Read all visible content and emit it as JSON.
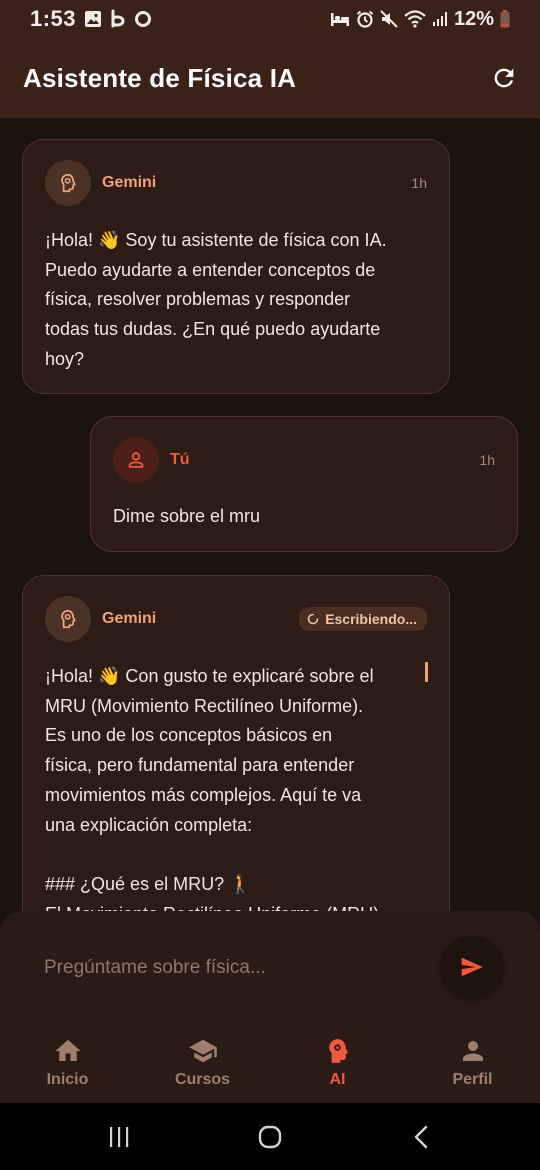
{
  "status_bar": {
    "time": "1:53",
    "battery": "12%",
    "left_icons": [
      "image-icon",
      "b-app-icon",
      "o-app-icon"
    ],
    "right_icons": [
      "bed-icon",
      "alarm-icon",
      "mute-icon",
      "wifi-icon",
      "signal-icon",
      "battery-icon"
    ]
  },
  "app_bar": {
    "title": "Asistente de Física IA",
    "refresh_icon": "refresh-icon"
  },
  "messages": [
    {
      "sender": "Gemini",
      "time": "1h",
      "text": "¡Hola! 👋 Soy tu asistente de física con IA.\nPuedo ayudarte a entender conceptos de\nfísica, resolver problemas y responder\ntodas tus dudas. ¿En qué puedo ayudarte\nhoy?"
    },
    {
      "sender": "Tú",
      "time": "1h",
      "text": "Dime sobre el mru"
    },
    {
      "sender": "Gemini",
      "status": "Escribiendo...",
      "text": "¡Hola! 👋 Con gusto te explicaré sobre el\nMRU (Movimiento Rectilíneo Uniforme).\nEs uno de los conceptos básicos en\nfísica, pero fundamental para entender\nmovimientos más complejos. Aquí te va\nuna explicación completa:\n\n### ¿Qué es el MRU? 🚶\nEl Movimiento Rectilíneo Uniforme (MRU)"
    }
  ],
  "input": {
    "placeholder": "Pregúntame sobre física...",
    "value": ""
  },
  "bottom_nav": [
    {
      "label": "Inicio",
      "icon": "home-icon",
      "active": false
    },
    {
      "label": "Cursos",
      "icon": "school-icon",
      "active": false
    },
    {
      "label": "AI",
      "icon": "psychology-icon",
      "active": true
    },
    {
      "label": "Perfil",
      "icon": "person-icon",
      "active": false
    }
  ],
  "colors": {
    "app_bar": "#3a2219",
    "background": "#1c120e",
    "bubble": "#2c1c15",
    "ai_accent": "#f0a27c",
    "user_accent": "#ef5a3f",
    "nav_inactive": "#9e7f6e"
  }
}
